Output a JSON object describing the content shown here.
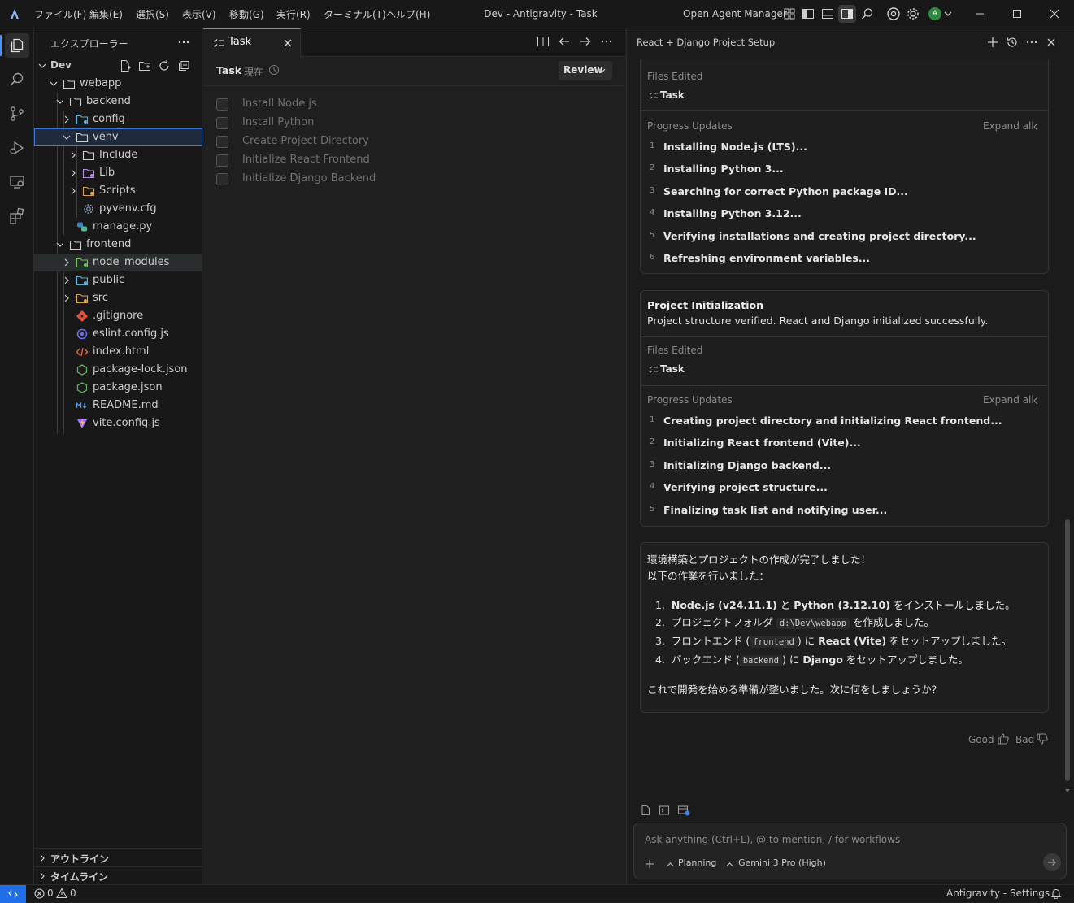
{
  "titlebar": {
    "menus": [
      "ファイル(F)",
      "編集(E)",
      "選択(S)",
      "表示(V)",
      "移動(G)",
      "実行(R)",
      "ターミナル(T)",
      "ヘルプ(H)"
    ],
    "window_title": "Dev - Antigravity - Task",
    "agent_manager": "Open Agent Manager",
    "avatar_letter": "A"
  },
  "explorer": {
    "title": "エクスプローラー",
    "root": "Dev",
    "items": [
      {
        "label": "webapp",
        "kind": "folder-open"
      },
      {
        "label": "backend",
        "kind": "folder-open"
      },
      {
        "label": "config",
        "kind": "folder-special"
      },
      {
        "label": "venv",
        "kind": "folder-open"
      },
      {
        "label": "Include",
        "kind": "folder"
      },
      {
        "label": "Lib",
        "kind": "folder-special"
      },
      {
        "label": "Scripts",
        "kind": "folder-special"
      },
      {
        "label": "pyvenv.cfg",
        "kind": "gear-file"
      },
      {
        "label": "manage.py",
        "kind": "python-file"
      },
      {
        "label": "frontend",
        "kind": "folder-open"
      },
      {
        "label": "node_modules",
        "kind": "folder-special"
      },
      {
        "label": "public",
        "kind": "folder-special"
      },
      {
        "label": "src",
        "kind": "folder-special"
      },
      {
        "label": ".gitignore",
        "kind": "git-file"
      },
      {
        "label": "eslint.config.js",
        "kind": "eslint-file"
      },
      {
        "label": "index.html",
        "kind": "html-file"
      },
      {
        "label": "package-lock.json",
        "kind": "node-file"
      },
      {
        "label": "package.json",
        "kind": "node-file"
      },
      {
        "label": "README.md",
        "kind": "md-file"
      },
      {
        "label": "vite.config.js",
        "kind": "vite-file"
      }
    ],
    "outline": "アウトライン",
    "timeline": "タイムライン"
  },
  "editor": {
    "tab_label": "Task",
    "header_title": "Task",
    "header_sub": "現在",
    "review_button": "Review",
    "tasks": [
      "Install Node.js",
      "Install Python",
      "Create Project Directory",
      "Initialize React Frontend",
      "Initialize Django Backend"
    ]
  },
  "agent": {
    "panel_title": "React + Django Project Setup",
    "card1": {
      "files_edited_label": "Files Edited",
      "file": "Task",
      "progress_label": "Progress Updates",
      "expand_all": "Expand all",
      "updates": [
        "Installing Node.js (LTS)...",
        "Installing Python 3...",
        "Searching for correct Python package ID...",
        "Installing Python 3.12...",
        "Verifying installations and creating project directory...",
        "Refreshing environment variables..."
      ]
    },
    "card2": {
      "title": "Project Initialization",
      "subtitle": "Project structure verified. React and Django initialized successfully.",
      "files_edited_label": "Files Edited",
      "file": "Task",
      "progress_label": "Progress Updates",
      "expand_all": "Expand all",
      "updates": [
        "Creating project directory and initializing React frontend...",
        "Initializing React frontend (Vite)...",
        "Initializing Django backend...",
        "Verifying project structure...",
        "Finalizing task list and notifying user..."
      ]
    },
    "message": {
      "line1": "環境構築とプロジェクトの作成が完了しました！",
      "line2": "以下の作業を行いました：",
      "li1": {
        "pre": "Node.js (v24.11.1)",
        "mid": " と ",
        "b2": "Python (3.12.10)",
        "post": " をインストールしました。"
      },
      "li2": {
        "pre": "プロジェクトフォルダ ",
        "code": "d:\\Dev\\webapp",
        "post": " を作成しました。"
      },
      "li3": {
        "pre": "フロントエンド (",
        "code": "frontend",
        "mid": ") に ",
        "b": "React (Vite)",
        "post": " をセットアップしました。"
      },
      "li4": {
        "pre": "バックエンド (",
        "code": "backend",
        "mid": ") に ",
        "b": "Django",
        "post": " をセットアップしました。"
      },
      "closing": "これで開発を始める準備が整いました。次に何をしましょうか？"
    },
    "feedback": {
      "good": "Good",
      "bad": "Bad"
    },
    "input_placeholder": "Ask anything (Ctrl+L), @ to mention, / for workflows",
    "mode": "Planning",
    "model": "Gemini 3 Pro (High)"
  },
  "statusbar": {
    "errors": "0",
    "warnings": "0",
    "right_label": "Antigravity - Settings"
  }
}
